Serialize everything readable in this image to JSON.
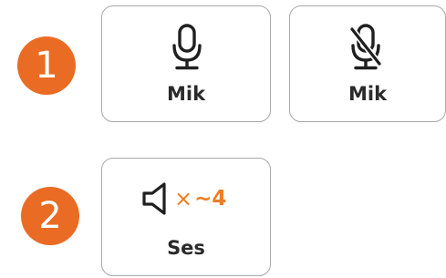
{
  "steps": [
    {
      "number": "1"
    },
    {
      "number": "2"
    }
  ],
  "mic_row": {
    "mic_button": {
      "label": "Mik",
      "icon": "microphone-icon",
      "state": "on"
    },
    "mic_muted_button": {
      "label": "Mik",
      "icon": "microphone-off-icon",
      "state": "muted"
    }
  },
  "sound_row": {
    "sound_button": {
      "label": "Ses",
      "icon": "speaker-icon",
      "mute_symbol": "×",
      "level_text": "~4"
    }
  },
  "colors": {
    "badge": "#ea6c24",
    "accent": "#ef7d22",
    "text": "#2a2a2a",
    "card_border": "#a8a8a8"
  }
}
